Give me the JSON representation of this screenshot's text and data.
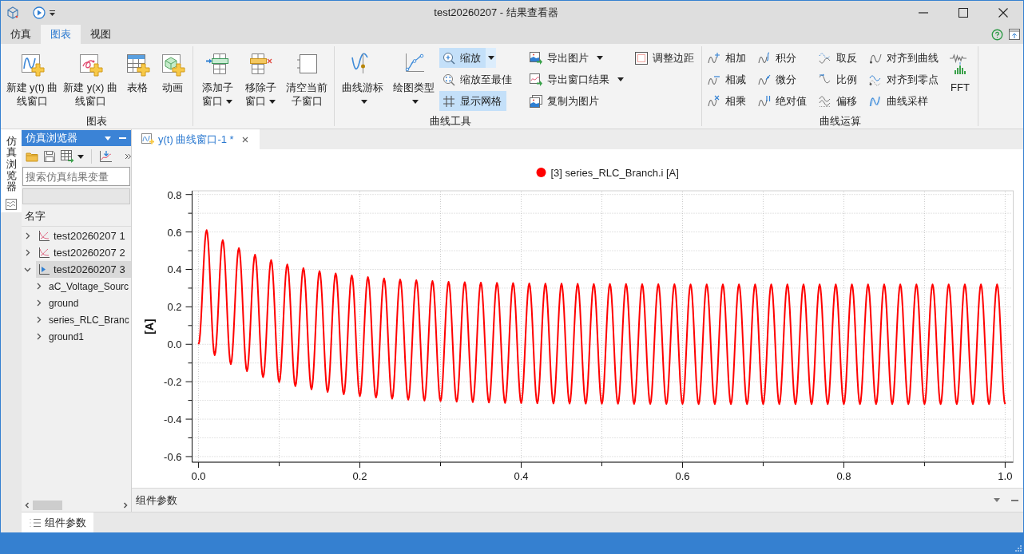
{
  "window": {
    "title": "test20260207 - 结果查看器"
  },
  "menu_tabs": [
    {
      "label": "仿真",
      "selected": false
    },
    {
      "label": "图表",
      "selected": true
    },
    {
      "label": "视图",
      "selected": false
    }
  ],
  "ribbon": {
    "groups": [
      {
        "label": "图表",
        "items": [
          {
            "kind": "large",
            "label": "新建 y(t) 曲线窗口",
            "dropdown": false
          },
          {
            "kind": "large",
            "label": "新建 y(x) 曲线窗口",
            "dropdown": false
          },
          {
            "kind": "large",
            "label": "表格",
            "dropdown": false
          },
          {
            "kind": "large",
            "label": "动画",
            "dropdown": false
          }
        ]
      },
      {
        "items": [
          {
            "kind": "large",
            "label": "添加子窗口",
            "dropdown": true
          },
          {
            "kind": "large",
            "label": "移除子窗口",
            "dropdown": true
          },
          {
            "kind": "large",
            "label": "清空当前子窗口",
            "dropdown": false
          }
        ]
      },
      {
        "label": "曲线工具",
        "items": [
          {
            "kind": "large",
            "label": "曲线游标",
            "dropdown": true
          },
          {
            "kind": "large",
            "label": "绘图类型",
            "dropdown": true
          },
          {
            "kind": "column",
            "items": [
              {
                "label": "缩放",
                "on": true,
                "dropdown": true
              },
              {
                "label": "缩放至最佳",
                "on": false,
                "dropdown": false
              },
              {
                "label": "显示网格",
                "on": true,
                "dropdown": false
              }
            ]
          },
          {
            "kind": "column",
            "items": [
              {
                "label": "导出图片",
                "dropdown": true
              },
              {
                "label": "导出窗口结果",
                "dropdown": true
              },
              {
                "label": "复制为图片",
                "dropdown": false
              }
            ]
          },
          {
            "kind": "column",
            "items": [
              {
                "label": "调整边距",
                "dropdown": false
              }
            ]
          }
        ]
      },
      {
        "label": "曲线运算",
        "items": [
          {
            "kind": "column",
            "items": [
              {
                "label": "相加",
                "dropdown": false
              },
              {
                "label": "相减",
                "dropdown": false
              },
              {
                "label": "相乘",
                "dropdown": false
              }
            ]
          },
          {
            "kind": "column",
            "items": [
              {
                "label": "积分",
                "dropdown": false
              },
              {
                "label": "微分",
                "dropdown": false
              },
              {
                "label": "绝对值",
                "dropdown": false
              }
            ]
          },
          {
            "kind": "column",
            "items": [
              {
                "label": "取反",
                "dropdown": false
              },
              {
                "label": "比例",
                "dropdown": false
              },
              {
                "label": "偏移",
                "dropdown": false
              }
            ]
          },
          {
            "kind": "column",
            "items": [
              {
                "label": "对齐到曲线",
                "dropdown": false
              },
              {
                "label": "对齐到零点",
                "dropdown": false
              },
              {
                "label": "曲线采样",
                "dropdown": false
              }
            ]
          },
          {
            "kind": "large",
            "label": "FFT",
            "dropdown": false
          }
        ]
      }
    ]
  },
  "side_tabs": [
    {
      "label": "仿真浏览器",
      "selected": true
    }
  ],
  "browser_panel": {
    "title": "仿真浏览器",
    "search": {
      "placeholder": "搜索仿真结果变量"
    },
    "tree_header": "名字",
    "tree": [
      {
        "label": "test20260207 1",
        "active": false,
        "expanded": false,
        "selected": false
      },
      {
        "label": "test20260207 2",
        "active": false,
        "expanded": false,
        "selected": false
      },
      {
        "label": "test20260207 3",
        "active": true,
        "expanded": true,
        "selected": true,
        "children": [
          {
            "label": "aC_Voltage_Sourc",
            "expanded": false,
            "selected": false
          },
          {
            "label": "ground",
            "expanded": false,
            "selected": false
          },
          {
            "label": "series_RLC_Branc",
            "expanded": false,
            "selected": false
          },
          {
            "label": "ground1",
            "expanded": false,
            "selected": false
          }
        ]
      }
    ]
  },
  "document_tabs": [
    {
      "label": "y(t) 曲线窗口-1 *",
      "selected": true
    }
  ],
  "plot": {
    "chart_data": {
      "type": "line",
      "ylabel": "[A]",
      "grid": true,
      "x": [
        0,
        0.01,
        0.02,
        0.03,
        0.04,
        0.05,
        0.06,
        0.07,
        0.08,
        0.09,
        0.1,
        0.11,
        0.12,
        0.13,
        0.14,
        0.15,
        0.16,
        0.17,
        0.18,
        0.19,
        0.2,
        0.21,
        0.22,
        0.23,
        0.24,
        0.25,
        0.26,
        0.27,
        0.28,
        0.29,
        0.3,
        0.31,
        0.32,
        0.33,
        0.34,
        0.35,
        0.36,
        0.37,
        0.38,
        0.39,
        0.4,
        0.41,
        0.42,
        0.43,
        0.44,
        0.45,
        0.46,
        0.47,
        0.48,
        0.49,
        0.5,
        0.51,
        0.52,
        0.53,
        0.54,
        0.55,
        0.56,
        0.57,
        0.58,
        0.59,
        0.6,
        0.61,
        0.62,
        0.63,
        0.64,
        0.65,
        0.66,
        0.67,
        0.68,
        0.69,
        0.7,
        0.71,
        0.72,
        0.73,
        0.74,
        0.75,
        0.76,
        0.77,
        0.78,
        0.79,
        0.8,
        0.81,
        0.82,
        0.83,
        0.84,
        0.85,
        0.86,
        0.87,
        0.88,
        0.89,
        0.9,
        0.91,
        0.92,
        0.93,
        0.94,
        0.95,
        0.96,
        0.97,
        0.98,
        0.99,
        1.0
      ],
      "series": [
        {
          "name": "[3] series_RLC_Branch.i [A]",
          "color": "#ff0000",
          "values": [
            0,
            0.61,
            -0.058,
            0.557,
            -0.106,
            0.514,
            -0.144,
            0.479,
            -0.176,
            0.45,
            -0.202,
            0.427,
            -0.224,
            0.407,
            -0.241,
            0.391,
            -0.255,
            0.379,
            -0.267,
            0.368,
            -0.277,
            0.359,
            -0.285,
            0.352,
            -0.291,
            0.346,
            -0.296,
            0.342,
            -0.301,
            0.338,
            -0.304,
            0.334,
            -0.307,
            0.332,
            -0.309,
            0.33,
            -0.311,
            0.328,
            -0.313,
            0.327,
            -0.314,
            0.325,
            -0.315,
            0.324,
            -0.316,
            0.324,
            -0.317,
            0.323,
            -0.317,
            0.322,
            -0.318,
            0.322,
            -0.318,
            0.322,
            -0.319,
            0.321,
            -0.319,
            0.321,
            -0.319,
            0.321,
            -0.319,
            0.32,
            -0.32,
            0.32,
            -0.32,
            0.32,
            -0.32,
            0.32,
            -0.32,
            0.32,
            -0.32,
            0.32,
            -0.32,
            0.32,
            -0.32,
            0.32,
            -0.32,
            0.32,
            -0.32,
            0.32,
            -0.32,
            0.32,
            -0.32,
            0.32,
            -0.32,
            0.32,
            -0.32,
            0.32,
            -0.32,
            0.32,
            -0.32,
            0.32,
            -0.32,
            0.32,
            -0.32,
            0.32,
            -0.32,
            0.32,
            -0.32,
            0.32,
            -0.32
          ]
        }
      ],
      "xlim": [
        -0.008,
        1.01
      ],
      "ylim": [
        -0.63,
        0.82
      ],
      "xticks": [
        {
          "value": 0,
          "label": "0.0"
        },
        {
          "value": 0.2,
          "label": "0.2"
        },
        {
          "value": 0.4,
          "label": "0.4"
        },
        {
          "value": 0.6,
          "label": "0.6"
        },
        {
          "value": 0.8,
          "label": "0.8"
        },
        {
          "value": 1.0,
          "label": "1.0"
        }
      ],
      "yticks": [
        {
          "value": -0.6,
          "label": "-0.6"
        },
        {
          "value": -0.4,
          "label": "-0.4"
        },
        {
          "value": -0.2,
          "label": "-0.2"
        },
        {
          "value": 0,
          "label": "0.0"
        },
        {
          "value": 0.2,
          "label": "0.2"
        },
        {
          "value": 0.4,
          "label": "0.4"
        },
        {
          "value": 0.6,
          "label": "0.6"
        },
        {
          "value": 0.8,
          "label": "0.8"
        }
      ]
    }
  },
  "properties_panel": {
    "title": "组件参数"
  },
  "bottom_tabs": [
    {
      "label": "组件参数",
      "selected": true
    }
  ]
}
